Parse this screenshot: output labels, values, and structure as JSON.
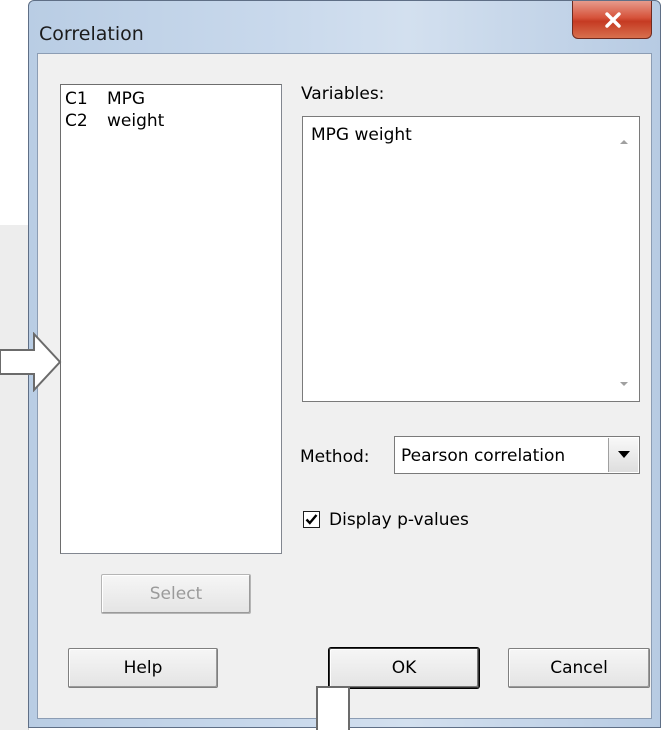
{
  "window": {
    "title": "Correlation",
    "close_icon": "close-icon"
  },
  "columns": [
    {
      "id": "C1",
      "name": "MPG"
    },
    {
      "id": "C2",
      "name": "weight"
    }
  ],
  "variables": {
    "label": "Variables:",
    "value": "MPG weight"
  },
  "method": {
    "label": "Method:",
    "selected": "Pearson correlation"
  },
  "display_pvalues": {
    "label": "Display p-values",
    "checked": true
  },
  "buttons": {
    "select": "Select",
    "help": "Help",
    "ok": "OK",
    "cancel": "Cancel"
  },
  "colors": {
    "close_button": "#c53a22",
    "dialog_background": "#f0f0f0"
  }
}
